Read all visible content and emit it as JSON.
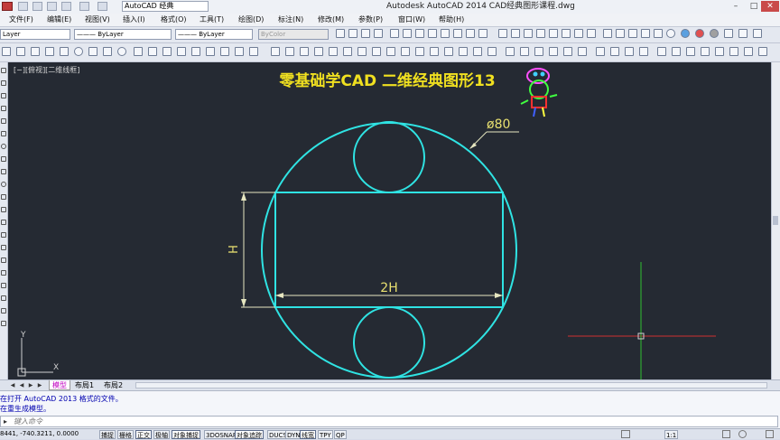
{
  "app": {
    "title": "Autodesk AutoCAD 2014    CAD经典图形课程.dwg",
    "workspace": "AutoCAD 经典"
  },
  "window_controls": {
    "minimize": "–",
    "maximize": "□",
    "close": "✕"
  },
  "menu": [
    "文件(F)",
    "编辑(E)",
    "视图(V)",
    "插入(I)",
    "格式(O)",
    "工具(T)",
    "绘图(D)",
    "标注(N)",
    "修改(M)",
    "参数(P)",
    "窗口(W)",
    "帮助(H)"
  ],
  "properties": {
    "layer": "Layer",
    "color": "ByLayer",
    "linetype": "ByLayer",
    "lineweight": "ByLayer",
    "plotstyle": "ByColor"
  },
  "viewport": {
    "label": "[−][俯视][二维线框]",
    "heading": "零基础学CAD 二维经典图形13",
    "dims": {
      "diameter": "ø80",
      "height": "H",
      "width": "2H"
    },
    "ucs": {
      "x": "X",
      "y": "Y"
    }
  },
  "layout_tabs": [
    "模型",
    "布局1",
    "布局2"
  ],
  "command": {
    "history": [
      "在打开 AutoCAD 2013 格式的文件。",
      "在重生成模型。"
    ],
    "placeholder": "键入命令"
  },
  "status": {
    "coords": "8441, -740.3211, 0.0000",
    "toggles": [
      "捕捉",
      "栅格",
      "正交",
      "极轴",
      "对象捕捉",
      "3DOSNAP",
      "对象追踪",
      "DUCS",
      "DYN",
      "线宽",
      "TPY",
      "QP"
    ],
    "scale": "1:1"
  },
  "colors": {
    "viewport_bg": "#252a33",
    "geometry": "#2fe3e3",
    "dimension": "#e6e6c0",
    "dim_text": "#e8e070",
    "heading": "#f0e020",
    "crosshair_x": "#d03030",
    "crosshair_y": "#30c030"
  }
}
